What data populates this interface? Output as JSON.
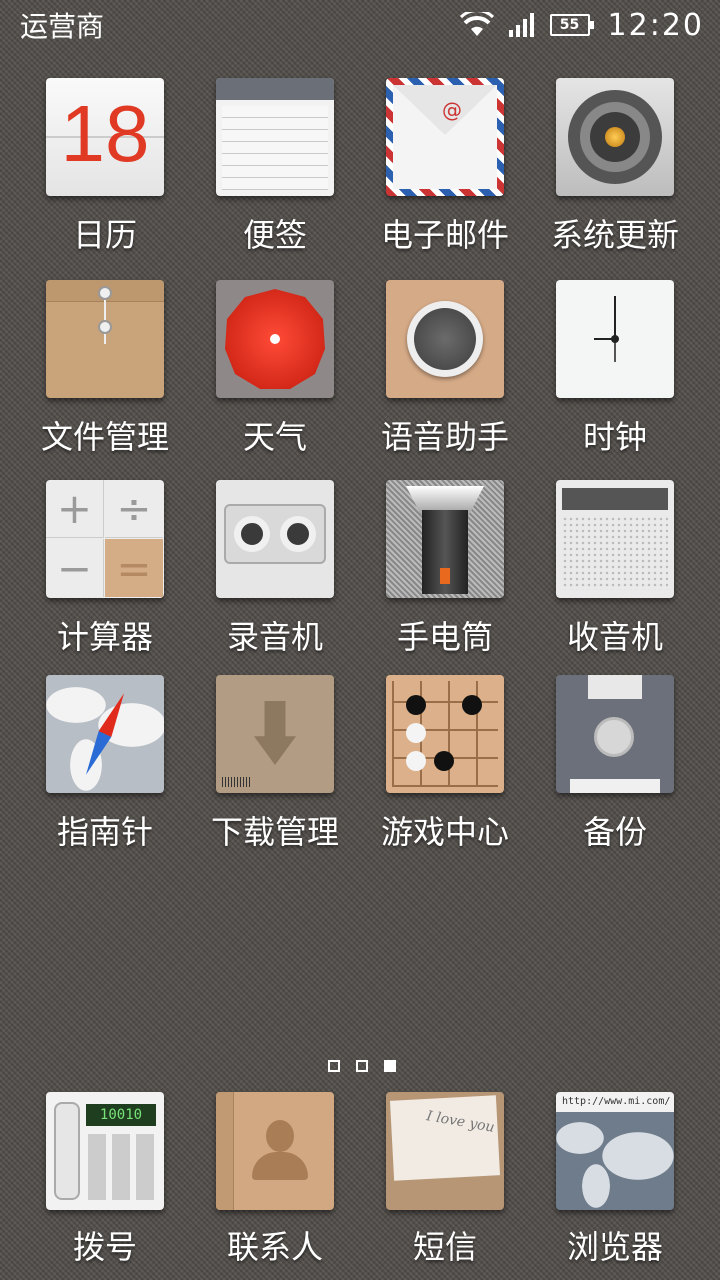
{
  "status_bar": {
    "carrier": "运营商",
    "battery": "55",
    "time": "12:20"
  },
  "apps": [
    {
      "label": "日历",
      "icon": "calendar-icon",
      "icon_text": "18"
    },
    {
      "label": "便签",
      "icon": "notes-icon"
    },
    {
      "label": "电子邮件",
      "icon": "mail-icon"
    },
    {
      "label": "系统更新",
      "icon": "system-update-icon"
    },
    {
      "label": "文件管理",
      "icon": "file-manager-icon"
    },
    {
      "label": "天气",
      "icon": "weather-icon"
    },
    {
      "label": "语音助手",
      "icon": "voice-assistant-icon"
    },
    {
      "label": "时钟",
      "icon": "clock-icon"
    },
    {
      "label": "计算器",
      "icon": "calculator-icon"
    },
    {
      "label": "录音机",
      "icon": "recorder-icon"
    },
    {
      "label": "手电筒",
      "icon": "flashlight-icon"
    },
    {
      "label": "收音机",
      "icon": "radio-icon"
    },
    {
      "label": "指南针",
      "icon": "compass-icon"
    },
    {
      "label": "下载管理",
      "icon": "download-manager-icon"
    },
    {
      "label": "游戏中心",
      "icon": "game-center-icon"
    },
    {
      "label": "备份",
      "icon": "backup-icon"
    }
  ],
  "page_indicator": {
    "pages": 3,
    "active": 3
  },
  "dock": [
    {
      "label": "拨号",
      "icon": "dialer-icon",
      "icon_text": "10010"
    },
    {
      "label": "联系人",
      "icon": "contacts-icon"
    },
    {
      "label": "短信",
      "icon": "messages-icon",
      "icon_text": "I love you"
    },
    {
      "label": "浏览器",
      "icon": "browser-icon",
      "icon_text": "http://www.mi.com/"
    }
  ]
}
